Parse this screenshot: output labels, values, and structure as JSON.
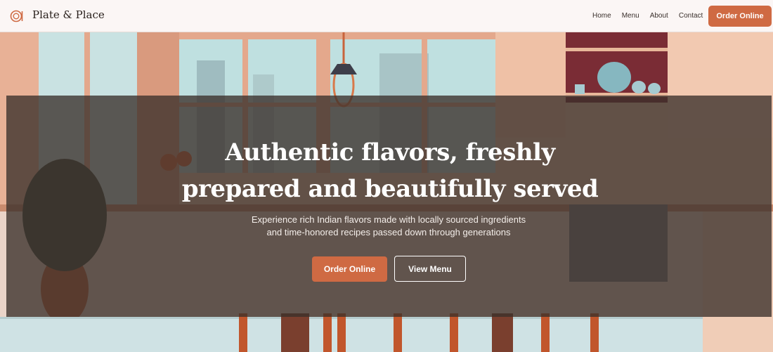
{
  "brand": {
    "name": "Plate & Place",
    "logo_icon": "plate-logo-icon"
  },
  "nav": {
    "items": [
      "Home",
      "Menu",
      "About",
      "Contact"
    ],
    "order_label": "Order Online"
  },
  "hero": {
    "title_line1": "Authentic flavors, freshly",
    "title_line2": "prepared and beautifully served",
    "subtitle_line1": "Experience rich Indian flavors made with locally sourced ingredients",
    "subtitle_line2": "and time-honored recipes passed down through generations",
    "primary_cta": "Order Online",
    "secondary_cta": "View Menu"
  },
  "colors": {
    "accent": "#cf6a43",
    "header_bg": "#fbf6f5",
    "overlay": "#3a2f2a"
  }
}
